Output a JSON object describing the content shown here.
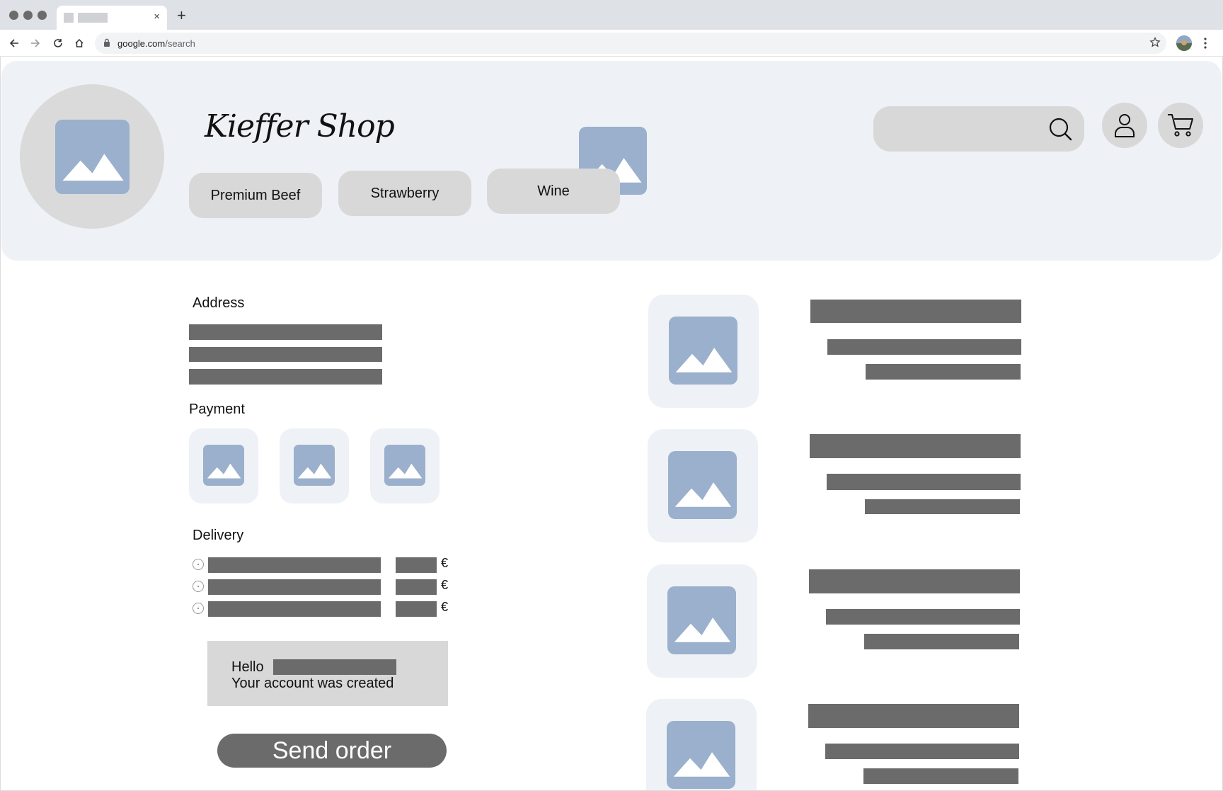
{
  "browser": {
    "url_host": "google.com",
    "url_path": "/search",
    "tab_close_glyph": "×",
    "new_tab_glyph": "+"
  },
  "shop": {
    "brand": "Kieffer Shop",
    "categories": [
      {
        "label": "Premium Beef"
      },
      {
        "label": "Strawberry"
      },
      {
        "label": "Wine"
      }
    ],
    "search_placeholder": ""
  },
  "checkout": {
    "address_label": "Address",
    "payment_label": "Payment",
    "delivery_label": "Delivery",
    "currency_symbol": "€",
    "notice_hello": "Hello",
    "notice_message": "Your account was created",
    "send_button": "Send order"
  },
  "colors": {
    "placeholder_image": "#9ab0cc",
    "panel_background": "#eef1f6",
    "control_grey": "#d8d8d8",
    "text_bar": "#6b6b6b"
  },
  "icons": [
    "back-icon",
    "forward-icon",
    "reload-icon",
    "home-icon",
    "lock-icon",
    "star-icon",
    "search-icon",
    "user-icon",
    "cart-icon",
    "image-placeholder-icon"
  ]
}
